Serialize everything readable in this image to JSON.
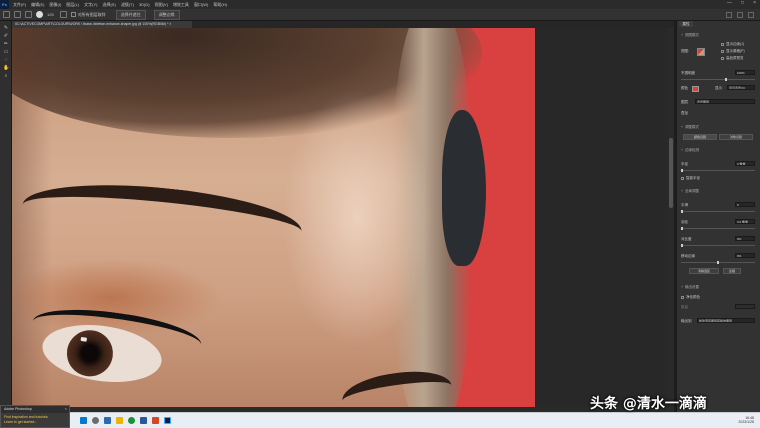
{
  "app": {
    "logo": "Ps"
  },
  "menubar": {
    "items": [
      "文件(F)",
      "编辑(E)",
      "图像(I)",
      "图层(L)",
      "文字(Y)",
      "选择(S)",
      "滤镜(T)",
      "3D(D)",
      "视图(V)",
      "增效工具",
      "窗口(W)",
      "帮助(H)"
    ],
    "window_controls": [
      "—",
      "□",
      "×"
    ]
  },
  "options": {
    "brush_size": "125",
    "btn_select_subject": "选择并遮住",
    "btn_mask": "调整边缘",
    "opt_sample": "对所有图层取样",
    "opt_enhance": "增强边缘"
  },
  "document": {
    "tab_title": "IIC:\\ACTIVECOMP\\ART\\COLOUR\\WORK \\ tbase-inbetwe-enhance-shaper.jpg @ 100%(RGB/8#) *  ×"
  },
  "panel": {
    "tab": "属性",
    "view_mode_title": "视图模式",
    "view_label": "视图:",
    "show_edge": "显示边缘(J)",
    "show_original": "显示原稿(P)",
    "realtime_refine": "高品质预览",
    "opacity_label": "不透明度",
    "opacity_value": "100%",
    "color_label": "颜色",
    "mode_label": "显示",
    "mode_value": "显示背景(V)",
    "layer_label": "图层",
    "layer_value": "背景图层",
    "overlay_label": "叠加",
    "refine_mode_title": "调整模式",
    "refine_color": "颜色识别",
    "refine_object": "对象识别",
    "edge_detection_title": "边缘检测",
    "radius_label": "半径",
    "radius_value": "0 像素",
    "smart_radius": "智能半径",
    "global_refine_title": "全局调整",
    "smooth_label": "平滑",
    "smooth_value": "0",
    "feather_label": "羽化",
    "feather_value": "0.0 像素",
    "contrast_label": "对比度",
    "contrast_value": "0%",
    "shift_edge_label": "移动边缘",
    "shift_edge_value": "0%",
    "clear_selection": "清除选区",
    "invert": "反相",
    "output_settings_title": "输出设置",
    "decontaminate": "净化颜色",
    "amount_label": "数量",
    "output_to_label": "输出到",
    "output_to_value": "新建带有图层蒙版的图层"
  },
  "notification": {
    "title": "Adobe Photoshop",
    "text1": "Find inspiration and tutorials",
    "text2": "Learn to get started..."
  },
  "taskbar": {
    "time": "16:48",
    "date": "2023/1/28"
  },
  "watermark": "头条 @清水一滴滴",
  "colors": {
    "accent": "#d8413f",
    "ps_blue": "#31a8ff"
  }
}
